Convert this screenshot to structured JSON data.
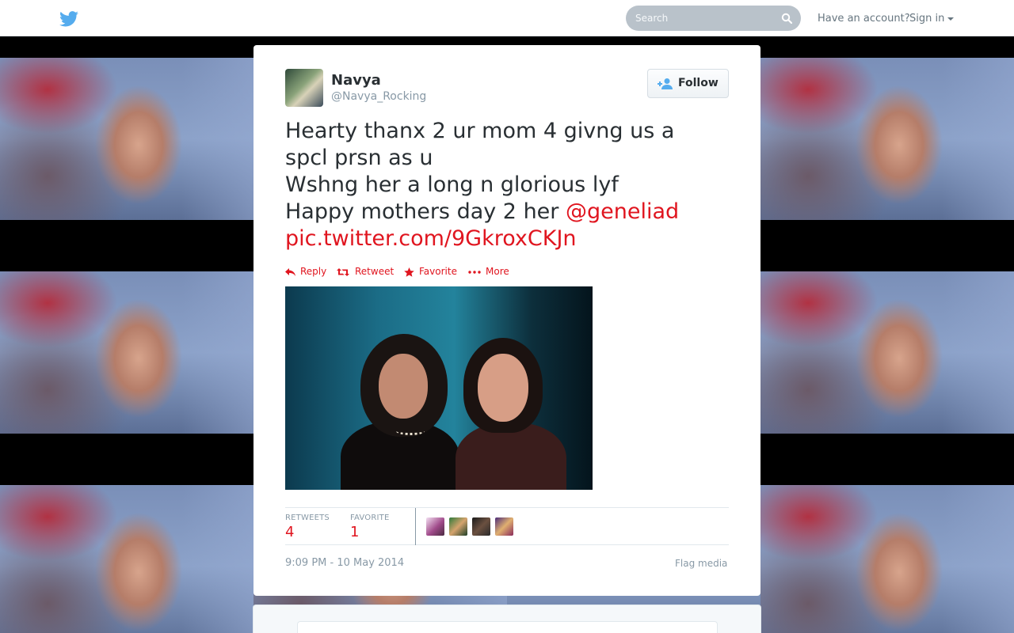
{
  "header": {
    "search_placeholder": "Search",
    "have_account": "Have an account?",
    "sign_in": "Sign in"
  },
  "tweet": {
    "fullname": "Navya",
    "username": "@Navya_Rocking",
    "follow_label": "Follow",
    "text_lines": [
      "Hearty thanx 2 ur mom 4 givng us a",
      "spcl prsn as u",
      "Wshng her a long n glorious lyf",
      "Happy mothers day 2 her "
    ],
    "mention": "@geneliad",
    "pic_link": "pic.twitter.com/9GkroxCKJn",
    "actions": {
      "reply": "Reply",
      "retweet": "Retweet",
      "favorite": "Favorite",
      "more": "More"
    },
    "stats": {
      "retweets_label": "RETWEETS",
      "retweets_value": "4",
      "favorites_label": "FAVORITE",
      "favorites_value": "1"
    },
    "timestamp": "9:09 PM - 10 May 2014",
    "flag_media": "Flag media"
  },
  "colors": {
    "link": "#e0151f",
    "twitter_blue": "#55acee",
    "text": "#292f33",
    "muted": "#8899a6"
  },
  "icons": [
    "twitter-bird-icon",
    "search-icon",
    "caret-down-icon",
    "follow-user-icon",
    "reply-icon",
    "retweet-icon",
    "star-icon",
    "more-icon"
  ]
}
